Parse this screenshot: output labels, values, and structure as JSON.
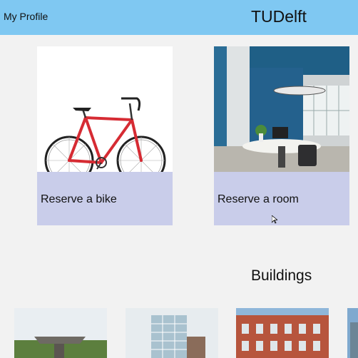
{
  "header": {
    "profile_label": "My Profile",
    "app_title": "TUDelft",
    "background": "#7fc8f2"
  },
  "cards": [
    {
      "label": "Reserve a bike",
      "image": "bicycle-illustration"
    },
    {
      "label": "Reserve a room",
      "image": "meeting-room-photo"
    }
  ],
  "buildings": {
    "title": "Buildings",
    "thumbnails": [
      "aula-building-photo",
      "glass-tower-photo",
      "brick-building-photo",
      "partial-building-photo"
    ]
  },
  "colors": {
    "card_label_bg": "#c9cdea",
    "page_bg": "#f2f2f2"
  }
}
